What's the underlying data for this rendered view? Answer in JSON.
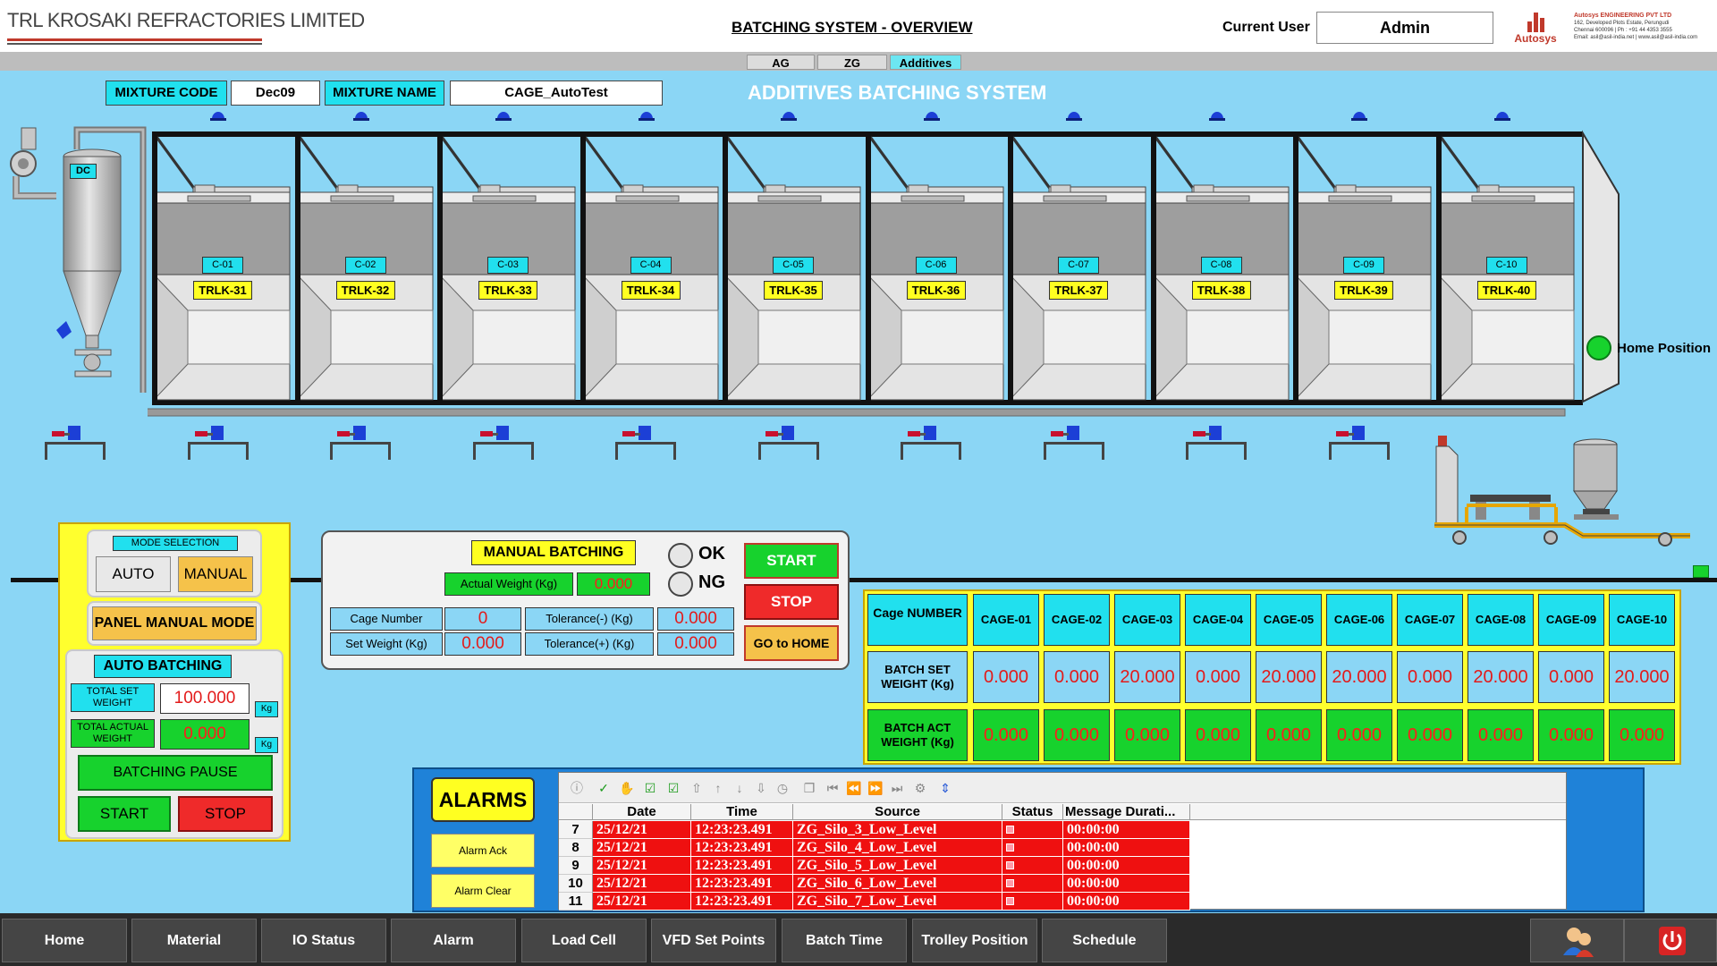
{
  "header": {
    "company": "TRL KROSAKI REFRACTORIES LIMITED",
    "title": "BATCHING SYSTEM - OVERVIEW",
    "current_user_label": "Current User",
    "current_user": "Admin",
    "vendor_logo_word": "Autosys",
    "vendor_name": "Autosys ENGINEERING PVT LTD",
    "vendor_address": "162, Developed Plots Estate, Perungudi",
    "vendor_phone": "Chennai 600096 | Ph : +91 44 4353 3555",
    "vendor_web": "Email: asil@asil-india.net | www.asil@asil-india.com"
  },
  "tabs": [
    "AG",
    "ZG",
    "Additives"
  ],
  "active_tab": "Additives",
  "mixture": {
    "code_label": "MIXTURE CODE",
    "code": "Dec09",
    "name_label": "MIXTURE NAME",
    "name": "CAGE_AutoTest"
  },
  "system_title": "ADDITIVES BATCHING SYSTEM",
  "dust_collector_label": "DC",
  "cages": [
    {
      "code": "C-01",
      "trolley": "TRLK-31"
    },
    {
      "code": "C-02",
      "trolley": "TRLK-32"
    },
    {
      "code": "C-03",
      "trolley": "TRLK-33"
    },
    {
      "code": "C-04",
      "trolley": "TRLK-34"
    },
    {
      "code": "C-05",
      "trolley": "TRLK-35"
    },
    {
      "code": "C-06",
      "trolley": "TRLK-36"
    },
    {
      "code": "C-07",
      "trolley": "TRLK-37"
    },
    {
      "code": "C-08",
      "trolley": "TRLK-38"
    },
    {
      "code": "C-09",
      "trolley": "TRLK-39"
    },
    {
      "code": "C-10",
      "trolley": "TRLK-40"
    }
  ],
  "home_position_label": "Home Position",
  "mode": {
    "title": "MODE SELECTION",
    "auto": "AUTO",
    "manual": "MANUAL",
    "panel_manual": "PANEL MANUAL MODE",
    "active": "MANUAL"
  },
  "auto_batching": {
    "title": "AUTO BATCHING",
    "total_set_label": "TOTAL SET WEIGHT",
    "total_set_value": "100.000",
    "total_actual_label": "TOTAL ACTUAL WEIGHT",
    "total_actual_value": "0.000",
    "unit": "Kg",
    "pause": "BATCHING PAUSE",
    "start": "START",
    "stop": "STOP"
  },
  "manual_batching": {
    "title": "MANUAL BATCHING",
    "actual_weight_label": "Actual Weight (Kg)",
    "actual_weight": "0.000",
    "cage_number_label": "Cage Number",
    "cage_number": "0",
    "set_weight_label": "Set Weight (Kg)",
    "set_weight": "0.000",
    "tol_minus_label": "Tolerance(-) (Kg)",
    "tol_minus": "0.000",
    "tol_plus_label": "Tolerance(+) (Kg)",
    "tol_plus": "0.000",
    "ok": "OK",
    "ng": "NG",
    "start": "START",
    "stop": "STOP",
    "home": "GO to HOME"
  },
  "cage_table": {
    "header_label": "Cage NUMBER",
    "set_label": "BATCH SET WEIGHT (Kg)",
    "act_label": "BATCH ACT WEIGHT (Kg)",
    "cages": [
      "CAGE-01",
      "CAGE-02",
      "CAGE-03",
      "CAGE-04",
      "CAGE-05",
      "CAGE-06",
      "CAGE-07",
      "CAGE-08",
      "CAGE-09",
      "CAGE-10"
    ],
    "set_weights": [
      "0.000",
      "0.000",
      "20.000",
      "0.000",
      "20.000",
      "20.000",
      "0.000",
      "20.000",
      "0.000",
      "20.000"
    ],
    "act_weights": [
      "0.000",
      "0.000",
      "0.000",
      "0.000",
      "0.000",
      "0.000",
      "0.000",
      "0.000",
      "0.000",
      "0.000"
    ]
  },
  "alarms": {
    "title": "ALARMS",
    "ack": "Alarm Ack",
    "clear": "Alarm Clear",
    "columns": [
      "Date",
      "Time",
      "Source",
      "Status",
      "Message Durati..."
    ],
    "rows": [
      {
        "n": "7",
        "date": "25/12/21",
        "time": "12:23:23.491",
        "source": "ZG_Silo_3_Low_Level",
        "duration": "00:00:00"
      },
      {
        "n": "8",
        "date": "25/12/21",
        "time": "12:23:23.491",
        "source": "ZG_Silo_4_Low_Level",
        "duration": "00:00:00"
      },
      {
        "n": "9",
        "date": "25/12/21",
        "time": "12:23:23.491",
        "source": "ZG_Silo_5_Low_Level",
        "duration": "00:00:00"
      },
      {
        "n": "10",
        "date": "25/12/21",
        "time": "12:23:23.491",
        "source": "ZG_Silo_6_Low_Level",
        "duration": "00:00:00"
      },
      {
        "n": "11",
        "date": "25/12/21",
        "time": "12:23:23.491",
        "source": "ZG_Silo_7_Low_Level",
        "duration": "00:00:00"
      }
    ]
  },
  "nav": [
    "Home",
    "Material",
    "IO Status",
    "Alarm",
    "Load Cell",
    "VFD Set Points",
    "Batch Time",
    "Trolley Position",
    "Schedule"
  ],
  "colors": {
    "background": "#8bd6f5",
    "cyan_label": "#21e0ee",
    "yellow": "#ffff21",
    "green": "#17d22d",
    "red": "#ef2a2a",
    "alarm_row": "#ef1010"
  }
}
